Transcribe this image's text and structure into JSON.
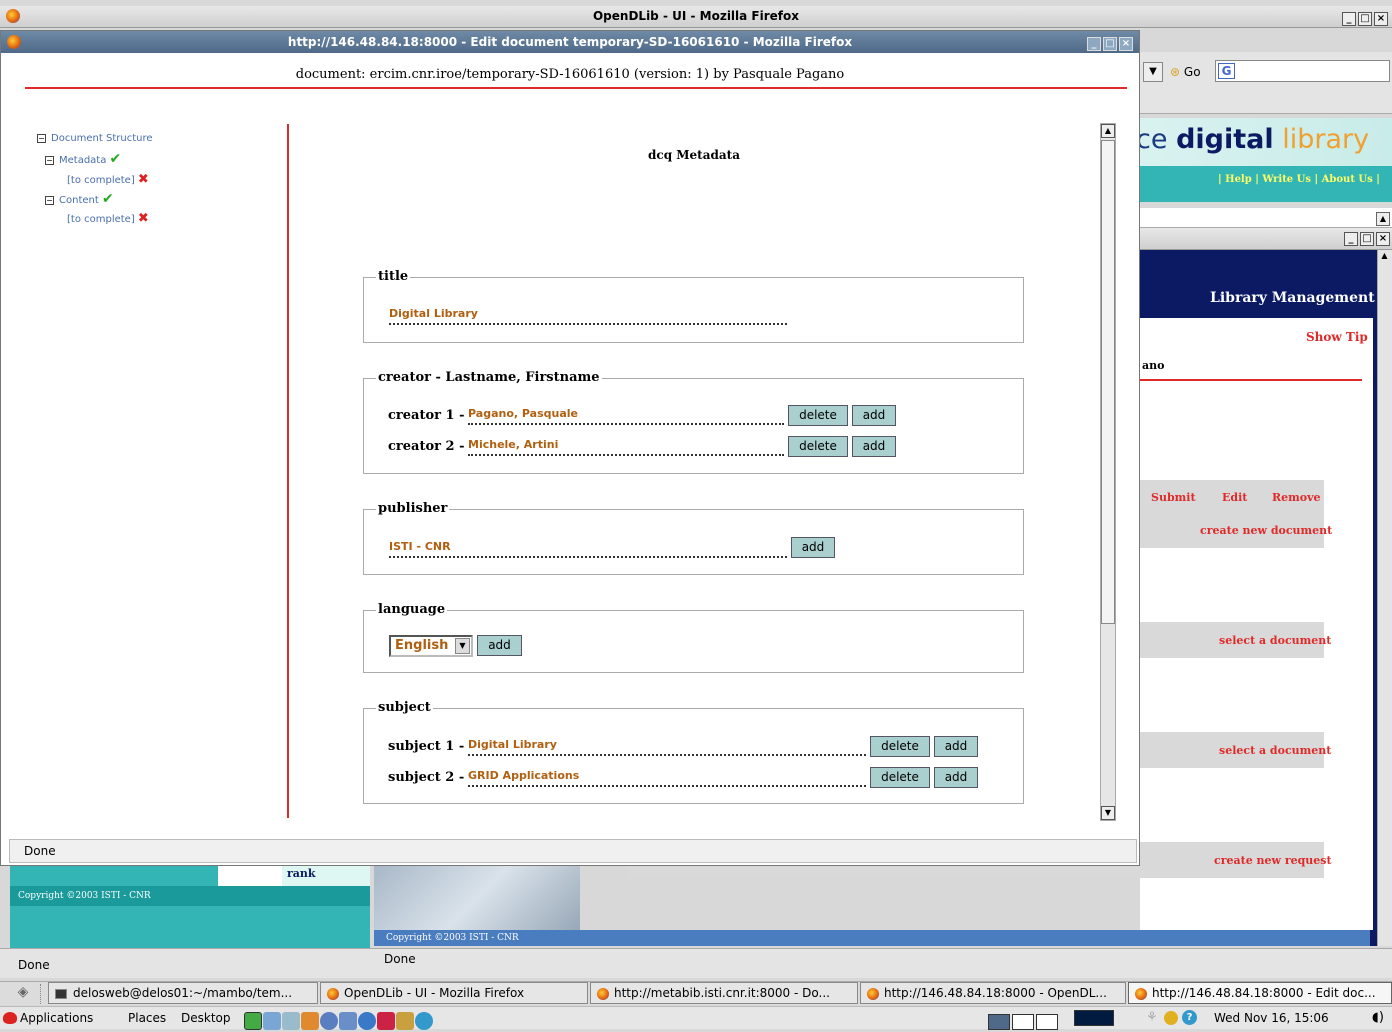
{
  "outer_window": {
    "title": "OpenDLib - UI - Mozilla Firefox"
  },
  "bg_browser": {
    "go_label": "Go",
    "banner": {
      "left": "ce",
      "digital": "digital",
      "library": "library"
    },
    "links": [
      {
        "label": "Help"
      },
      {
        "label": "Write Us"
      },
      {
        "label": "About Us"
      }
    ],
    "library_management": "Library Management",
    "show_tip": "Show Tip",
    "user_fragment": "ano",
    "actions": {
      "submit": "Submit",
      "edit": "Edit",
      "remove": "Remove"
    },
    "create_new_document": "create new document",
    "select_a_document_1": "select a document",
    "select_a_document_2": "select a document",
    "create_new_request": "create new request",
    "rank": "rank",
    "copyright_left": "Copyright ©2003 ISTI - CNR",
    "copyright_mid": "Copyright ©2003 ISTI - CNR",
    "status_left": "Done",
    "status_mid": "Done"
  },
  "edit_window": {
    "title": "http://146.48.84.18:8000 - Edit document temporary-SD-16061610 - Mozilla Firefox",
    "header": "document: ercim.cnr.iroe/temporary-SD-16061610 (version: 1) by Pasquale Pagano",
    "status": "Done",
    "tree": {
      "root": "Document Structure",
      "metadata": "Metadata",
      "metadata_todo": "[to complete]",
      "content": "Content",
      "content_todo": "[to complete]"
    },
    "form": {
      "heading": "dcq Metadata",
      "title_legend": "title",
      "title_value": "Digital Library",
      "creator_legend": "creator - Lastname, Firstname",
      "creators": [
        {
          "label": "creator 1 -",
          "value": "Pagano, Pasquale"
        },
        {
          "label": "creator 2 -",
          "value": "Michele, Artini"
        }
      ],
      "publisher_legend": "publisher",
      "publisher_value": "ISTI - CNR",
      "language_legend": "language",
      "language_value": "English",
      "subject_legend": "subject",
      "subjects": [
        {
          "label": "subject 1 -",
          "value": "Digital Library"
        },
        {
          "label": "subject 2 -",
          "value": "GRID Applications"
        }
      ],
      "delete_label": "delete",
      "add_label": "add"
    }
  },
  "taskbar": {
    "items": [
      {
        "label": "delosweb@delos01:~/mambo/tem..."
      },
      {
        "label": "OpenDLib - UI - Mozilla Firefox"
      },
      {
        "label": "http://metabib.isti.cnr.it:8000 - Do..."
      },
      {
        "label": "http://146.48.84.18:8000 - OpenDL..."
      },
      {
        "label": "http://146.48.84.18:8000 - Edit doc..."
      }
    ]
  },
  "panel": {
    "applications": "Applications",
    "places": "Places",
    "desktop": "Desktop",
    "clock": "Wed Nov 16, 15:06"
  },
  "colors": {
    "accent_red": "#e02a2a",
    "value_orange": "#b06010",
    "button_teal": "#a9cfcf",
    "banner_teal": "#33b5b5",
    "navy": "#0b1a63"
  }
}
